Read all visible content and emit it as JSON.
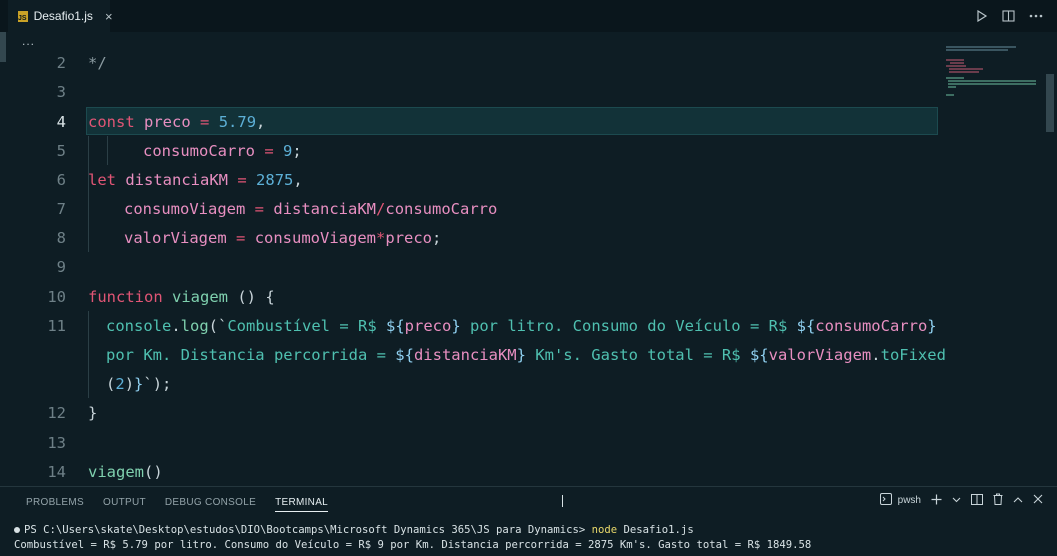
{
  "tab": {
    "filename": "Desafio1.js",
    "badge": "JS",
    "close": "×"
  },
  "breadcrumb": "...",
  "lines": [
    {
      "n": "2",
      "active": false
    },
    {
      "n": "3",
      "active": false
    },
    {
      "n": "4",
      "active": true
    },
    {
      "n": "5",
      "active": false
    },
    {
      "n": "6",
      "active": false
    },
    {
      "n": "7",
      "active": false
    },
    {
      "n": "8",
      "active": false
    },
    {
      "n": "9",
      "active": false
    },
    {
      "n": "10",
      "active": false
    },
    {
      "n": "11",
      "active": false
    },
    {
      "n": "",
      "active": false
    },
    {
      "n": "",
      "active": false
    },
    {
      "n": "12",
      "active": false
    },
    {
      "n": "13",
      "active": false
    },
    {
      "n": "14",
      "active": false
    }
  ],
  "code": {
    "l2": "*/",
    "l4_kw": "const",
    "l4_var": "preco",
    "l4_op": "=",
    "l4_num": "5.79",
    "l4_p": ",",
    "l5_var": "consumoCarro",
    "l5_op": "=",
    "l5_num": "9",
    "l5_p": ";",
    "l6_kw": "let",
    "l6_var": "distanciaKM",
    "l6_op": "=",
    "l6_num": "2875",
    "l6_p": ",",
    "l7_var": "consumoViagem",
    "l7_op": "=",
    "l7_a": "distanciaKM",
    "l7_op2": "/",
    "l7_b": "consumoCarro",
    "l8_var": "valorViagem",
    "l8_op": "=",
    "l8_a": "consumoViagem",
    "l8_op2": "*",
    "l8_b": "preco",
    "l8_p": ";",
    "l10_kw": "function",
    "l10_fn": "viagem",
    "l10_rest": "() {",
    "l11_obj": "console",
    "l11_dot": ".",
    "l11_fn": "log",
    "l11_open": "(`",
    "l11_s1": "Combustível = R$ ",
    "l11_t1o": "${",
    "l11_v1": "preco",
    "l11_t1c": "}",
    "l11_s2": " por litro. Consumo do Veículo = R$ ",
    "l11_t2o": "${",
    "l11_v2": "consumoCarro",
    "l11_t2c": "}",
    "l11b_s3": "por Km. Distancia percorrida = ",
    "l11b_t3o": "${",
    "l11b_v3": "distanciaKM",
    "l11b_t3c": "}",
    "l11b_s4": " Km's. Gasto total = R$ ",
    "l11b_t4o": "${",
    "l11b_v4": "valorViagem",
    "l11b_dot": ".",
    "l11b_fn": "toFixed",
    "l11c_open": "(",
    "l11c_num": "2",
    "l11c_close": ")",
    "l11c_t4c": "}",
    "l11c_end": "`);",
    "l12": "}",
    "l14_fn": "viagem",
    "l14_rest": "()"
  },
  "panel": {
    "tabs": [
      "PROBLEMS",
      "OUTPUT",
      "DEBUG CONSOLE",
      "TERMINAL"
    ],
    "shell": "pwsh",
    "terminal_prompt": "PS C:\\Users\\skate\\Desktop\\estudos\\DIO\\Bootcamps\\Microsoft Dynamics 365\\JS para Dynamics> ",
    "terminal_cmd": "node",
    "terminal_arg": " Desafio1.js",
    "terminal_output": "Combustível = R$ 5.79 por litro. Consumo do Veículo = R$ 9 por Km. Distancia percorrida = 2875 Km's. Gasto total = R$ 1849.58"
  },
  "colors": {
    "background": "#0e1d24",
    "keyword": "#e05575",
    "variable": "#e88fc1",
    "number": "#5db0d7",
    "string": "#4fc0b0"
  }
}
